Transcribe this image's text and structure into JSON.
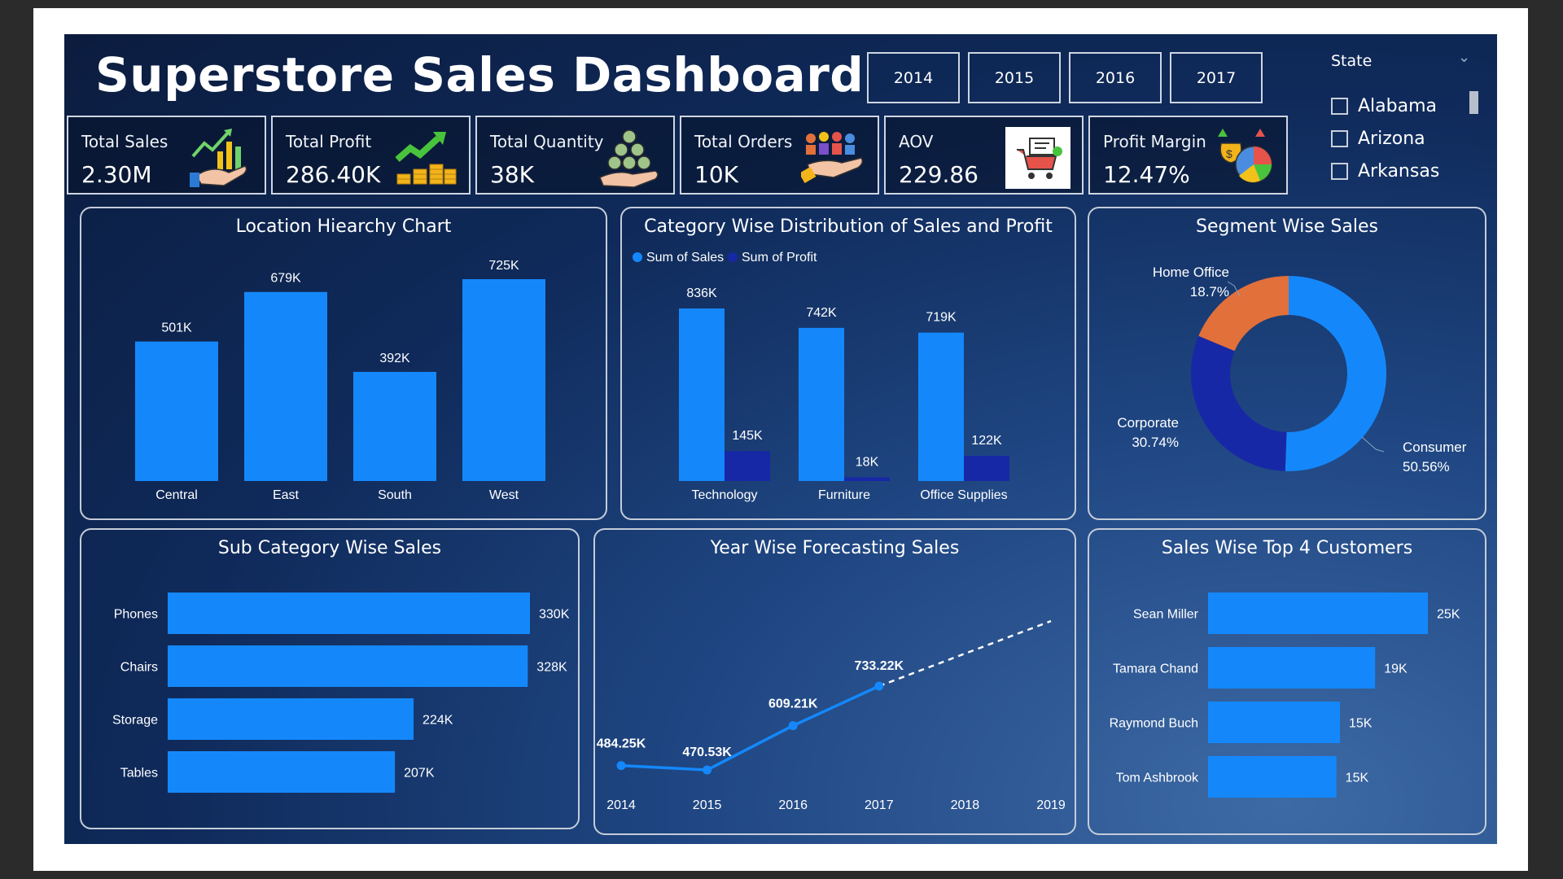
{
  "title": "Superstore Sales Dashboard",
  "years": [
    "2014",
    "2015",
    "2016",
    "2017"
  ],
  "state_filter": {
    "label": "State",
    "options": [
      "Alabama",
      "Arizona",
      "Arkansas"
    ]
  },
  "kpis": [
    {
      "label": "Total Sales",
      "value": "2.30M",
      "icon": "sales-growth-icon"
    },
    {
      "label": "Total Profit",
      "value": "286.40K",
      "icon": "profit-coins-icon"
    },
    {
      "label": "Total Quantity",
      "value": "38K",
      "icon": "money-bags-icon"
    },
    {
      "label": "Total Orders",
      "value": "10K",
      "icon": "customers-hand-icon"
    },
    {
      "label": "AOV",
      "value": "229.86",
      "icon": "shopping-cart-icon"
    },
    {
      "label": "Profit Margin",
      "value": "12.47%",
      "icon": "money-bag-pie-icon"
    }
  ],
  "colors": {
    "primary": "#1488fb",
    "secondary": "#1728a6",
    "accent_orange": "#e2703a",
    "accent_yellow": "#f2c21a"
  },
  "charts": {
    "location": {
      "title": "Location Hiearchy Chart",
      "chart_data": {
        "type": "bar",
        "categories": [
          "Central",
          "East",
          "South",
          "West"
        ],
        "values": [
          501,
          679,
          392,
          725
        ],
        "labels": [
          "501K",
          "679K",
          "392K",
          "725K"
        ]
      }
    },
    "category": {
      "title": "Category Wise Distribution of Sales and Profit",
      "legend": [
        "Sum of Sales",
        "Sum of Profit"
      ],
      "chart_data": {
        "type": "bar",
        "categories": [
          "Technology",
          "Furniture",
          "Office Supplies"
        ],
        "series": [
          {
            "name": "Sum of Sales",
            "values": [
              836,
              742,
              719
            ],
            "labels": [
              "836K",
              "742K",
              "719K"
            ]
          },
          {
            "name": "Sum of Profit",
            "values": [
              145,
              18,
              122
            ],
            "labels": [
              "145K",
              "18K",
              "122K"
            ]
          }
        ]
      }
    },
    "segment": {
      "title": "Segment Wise Sales",
      "chart_data": {
        "type": "pie",
        "slices": [
          {
            "name": "Consumer",
            "value": 50.56,
            "label": "50.56%"
          },
          {
            "name": "Corporate",
            "value": 30.74,
            "label": "30.74%"
          },
          {
            "name": "Home Office",
            "value": 18.7,
            "label": "18.7%"
          }
        ]
      }
    },
    "subcategory": {
      "title": "Sub Category Wise Sales",
      "chart_data": {
        "type": "bar",
        "orientation": "horizontal",
        "categories": [
          "Phones",
          "Chairs",
          "Storage",
          "Tables"
        ],
        "values": [
          330,
          328,
          224,
          207
        ],
        "labels": [
          "330K",
          "328K",
          "224K",
          "207K"
        ]
      }
    },
    "forecast": {
      "title": "Year Wise Forecasting Sales",
      "chart_data": {
        "type": "line",
        "x": [
          "2014",
          "2015",
          "2016",
          "2017",
          "2018",
          "2019"
        ],
        "actual": [
          484.25,
          470.53,
          609.21,
          733.22
        ],
        "labels": [
          "484.25K",
          "470.53K",
          "609.21K",
          "733.22K"
        ],
        "forecast_end": 937
      }
    },
    "customers": {
      "title": "Sales Wise Top 4 Customers",
      "chart_data": {
        "type": "bar",
        "orientation": "horizontal",
        "categories": [
          "Sean Miller",
          "Tamara Chand",
          "Raymond Buch",
          "Tom Ashbrook"
        ],
        "values": [
          25,
          19,
          15,
          14.6
        ],
        "labels": [
          "25K",
          "19K",
          "15K",
          "15K"
        ]
      }
    }
  }
}
